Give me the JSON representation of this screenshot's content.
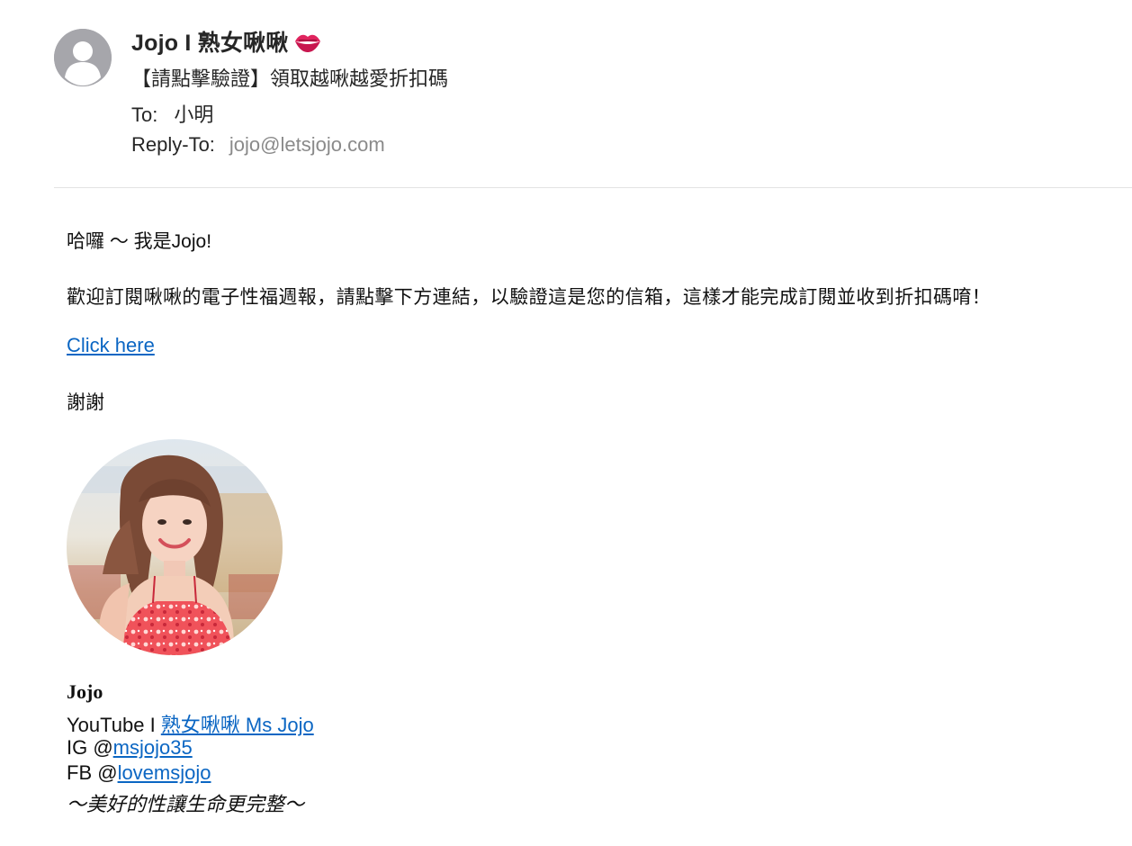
{
  "header": {
    "sender_name": "Jojo I 熟女啾啾",
    "sender_emoji_icon": "kiss-lips-icon",
    "subject": "【請點擊驗證】領取越啾越愛折扣碼",
    "to_label": "To:",
    "to_value": "小明",
    "reply_to_label": "Reply-To:",
    "reply_to_value": "jojo@letsjojo.com"
  },
  "body": {
    "greeting": "哈囉 ～ 我是Jojo!",
    "intro": "歡迎訂閱啾啾的電子性福週報，請點擊下方連結，以驗證這是您的信箱，這樣才能完成訂閱並收到折扣碼唷！",
    "link_text": "Click here",
    "thanks": "謝謝"
  },
  "signature": {
    "name": "Jojo",
    "youtube_prefix": "YouTube I ",
    "youtube_link": "熟女啾啾 Ms Jojo",
    "ig_prefix": "IG @",
    "ig_link": "msjojo35",
    "fb_prefix": "FB @",
    "fb_link": "lovemsjojo",
    "motto": "～美好的性讓生命更完整～"
  },
  "colors": {
    "link": "#0b66c3",
    "muted": "#8a8a8a",
    "avatar_bg": "#a6a6ab"
  }
}
